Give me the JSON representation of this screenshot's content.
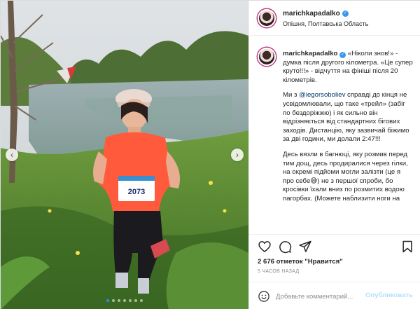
{
  "post": {
    "username": "marichkapadalko",
    "location": "Опішня, Полтавська Область",
    "bib_number": "2073",
    "caption_paragraphs": [
      {
        "text": "«Ніколи знов!» - думка після другого кілометра. «Це супер круто!!!» - відчуття на фініші після 20 кілометрів."
      },
      {
        "pre": "Ми з ",
        "mention": "@iegorsoboliev",
        "text": " справді до кінця не усвідомлювали, що таке «трейл» (забіг по бездоріжжю) і як сильно він відрізняється від стандартних бігових заходів. Дистанцію, яку зазвичай біжимо за дві години, ми долали 2:47!!!"
      },
      {
        "text": "Десь вязли в багнюці, яку розмив перед тим дощ, десь продиралися через гілки, на окремі підйоми могли залізти (це я про себе😅) не з першої спроби, бо кросівки їхали вниз по розмитих водою пагорбах. (Можете наблизити ноги на"
      }
    ],
    "likes": "2 676 отметок \"Нравится\"",
    "time": "5 ЧАСОВ НАЗАД",
    "comment_placeholder": "Добавьте комментарий...",
    "publish_label": "Опубликовать",
    "carousel": {
      "count": 7,
      "active_index": 0
    }
  },
  "icons": {
    "like": "heart-icon",
    "comment": "comment-icon",
    "share": "paper-plane-icon",
    "save": "bookmark-icon",
    "emoji": "smiley-icon",
    "prev": "chevron-left-icon",
    "next": "chevron-right-icon",
    "verified": "verified-badge-icon"
  },
  "colors": {
    "accent": "#3897f0",
    "mention": "#00376b",
    "muted": "#8e8e8e",
    "shirt": "#ff5a3c"
  }
}
